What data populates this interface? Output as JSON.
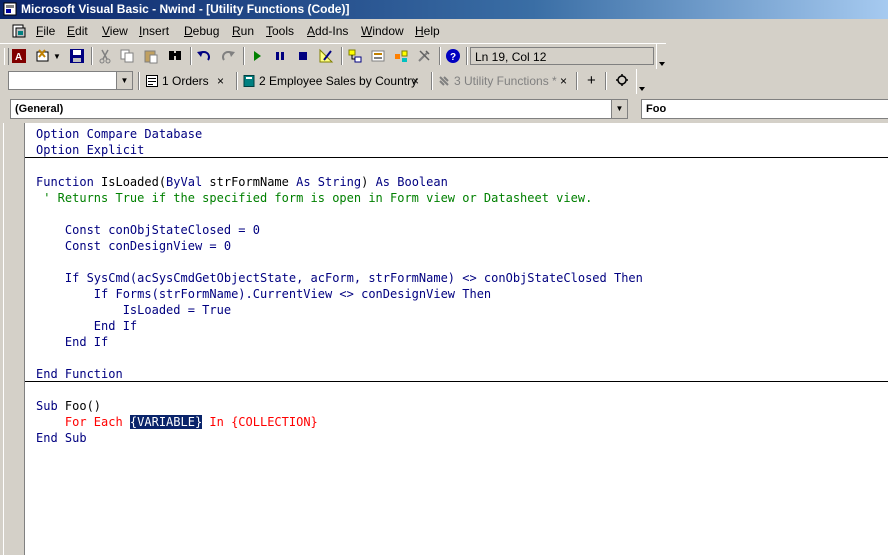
{
  "window": {
    "title": "Microsoft Visual Basic - Nwind - [Utility Functions (Code)]"
  },
  "menu": [
    {
      "key": "F",
      "rest": "ile"
    },
    {
      "key": "E",
      "rest": "dit"
    },
    {
      "key": "V",
      "rest": "iew"
    },
    {
      "key": "I",
      "rest": "nsert"
    },
    {
      "key": "D",
      "rest": "ebug"
    },
    {
      "key": "R",
      "rest": "un"
    },
    {
      "key": "T",
      "rest": "ools"
    },
    {
      "key": "A",
      "rest": "dd-Ins"
    },
    {
      "key": "W",
      "rest": "indow"
    },
    {
      "key": "H",
      "rest": "elp"
    }
  ],
  "toolbar": {
    "position": "Ln 19, Col 12",
    "icons": [
      "access-icon",
      "insert-module-icon",
      "save-icon",
      "cut-icon",
      "copy-icon",
      "paste-icon",
      "find-icon",
      "undo-icon",
      "redo-icon",
      "run-icon",
      "break-icon",
      "reset-icon",
      "design-mode-icon",
      "project-explorer-icon",
      "properties-icon",
      "object-browser-icon",
      "toolbox-icon",
      "help-icon"
    ]
  },
  "tabs": [
    {
      "label": "1 Orders",
      "close": "×",
      "icon": "form-icon"
    },
    {
      "label": "2 Employee Sales by Country",
      "close": "×",
      "icon": "report-icon"
    },
    {
      "label": "3 Utility Functions *",
      "close": "×",
      "icon": "module-icon"
    }
  ],
  "tab_extra": {
    "add": "+"
  },
  "object_combo": "(General)",
  "procedure_combo": "Foo",
  "colors": {
    "keyword": "#000080",
    "comment": "#008000",
    "error": "#ff0000",
    "highlight": "#0a246a"
  },
  "code": {
    "l1_a": "Option Compare Database",
    "l2_a": "Option Explicit",
    "l4_a": "Function",
    "l4_b": " IsLoaded(",
    "l4_c": "ByVal",
    "l4_d": " strFormName ",
    "l4_e": "As String",
    "l4_f": ") ",
    "l4_g": "As Boolean",
    "l5_a": " ' Returns True if the specified form is open in Form view or Datasheet view.",
    "l7_a": "    Const conObjStateClosed = 0",
    "l8_a": "    Const conDesignView = 0",
    "l10_a": "    If SysCmd(acSysCmdGetObjectState, acForm, strFormName) <> conObjStateClosed Then",
    "l11_a": "        If Forms(strFormName).CurrentView <> conDesignView Then",
    "l12_a": "            IsLoaded = ",
    "l12_b": "True",
    "l13_a": "        End If",
    "l14_a": "    End If",
    "l16_a": "End Function",
    "l18_a": "Sub",
    "l18_b": " Foo()",
    "l19_a": "    For Each ",
    "l19_b": "{VARIABLE}",
    "l19_c": " In {COLLECTION}",
    "l20_a": "End Sub"
  }
}
